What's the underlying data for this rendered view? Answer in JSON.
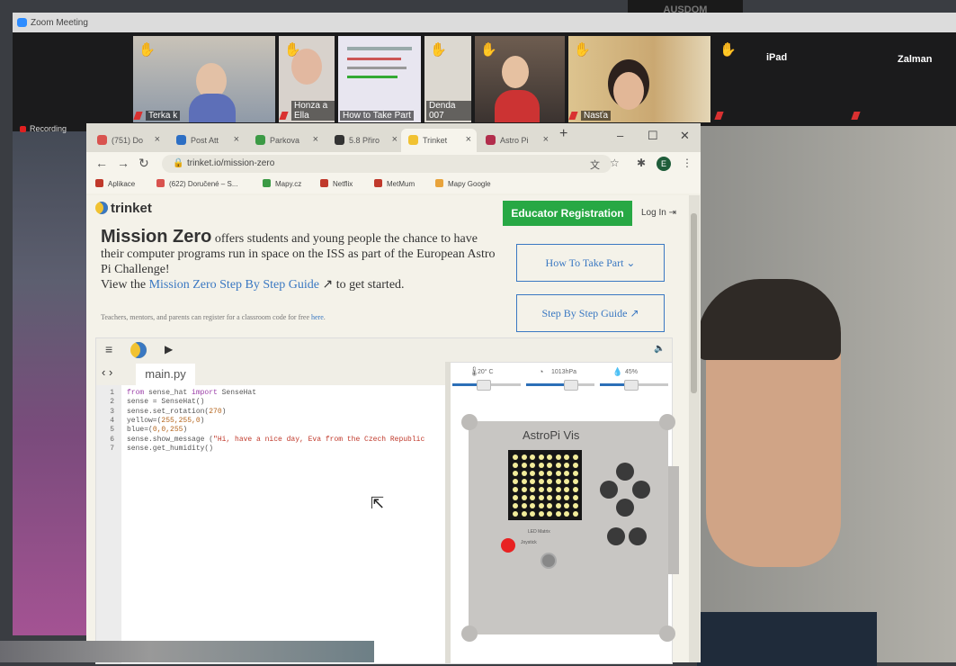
{
  "zoom": {
    "window_title": "Zoom Meeting",
    "notch_text": "AUSDOM",
    "recording_label": "Recording",
    "participants": [
      {
        "name": "Terka k"
      },
      {
        "name": "Honza a Ella"
      },
      {
        "name": "How to Take Part"
      },
      {
        "name": "Denda 007"
      },
      {
        "name": ""
      },
      {
        "name": "Nasťa"
      },
      {
        "name": "iPad"
      },
      {
        "name": "Zalman"
      }
    ]
  },
  "browser": {
    "tabs": [
      {
        "label": "(751) Do",
        "icon_color": "#d9534f"
      },
      {
        "label": "Post Att",
        "icon_color": "#2d6fc4"
      },
      {
        "label": "Parkova",
        "icon_color": "#3c9a45"
      },
      {
        "label": "5.8 Přiro",
        "icon_color": "#333333"
      },
      {
        "label": "Trinket",
        "icon_color": "#f1c232"
      },
      {
        "label": "Astro Pi",
        "icon_color": "#b22d4c"
      }
    ],
    "url": "trinket.io/mission-zero",
    "profile_initial": "E",
    "bookmarks": [
      {
        "label": "Aplikace",
        "icon_color": "#c0392b"
      },
      {
        "label": "(622) Doručené – S...",
        "icon_color": "#d9534f"
      },
      {
        "label": "Mapy.cz",
        "icon_color": "#3c9a45"
      },
      {
        "label": "Netflix",
        "icon_color": "#c0392b"
      },
      {
        "label": "MetMum",
        "icon_color": "#c0392b"
      },
      {
        "label": "Mapy Google",
        "icon_color": "#e8a33b"
      }
    ]
  },
  "trinket": {
    "logo": "trinket",
    "educator_button": "Educator Registration",
    "login": "Log In",
    "headline": "Mission Zero",
    "intro": "offers students and young people the chance to have their computer programs run in space on the ISS as part of the European Astro Pi Challenge!",
    "view_prefix": "View the",
    "guide_link": "Mission Zero Step By Step Guide",
    "view_suffix": "to get started.",
    "teachers_text": "Teachers, mentors, and parents can register for a classroom code for free",
    "teachers_link": "here",
    "how_to_button": "How To Take Part",
    "guide_button": "Step By Step Guide",
    "file_tab": "main.py",
    "code_lines": [
      {
        "n": "1",
        "segments": [
          {
            "t": "from",
            "c": "k"
          },
          {
            "t": " sense_hat ",
            "c": ""
          },
          {
            "t": "import",
            "c": "k"
          },
          {
            "t": " SenseHat",
            "c": ""
          }
        ]
      },
      {
        "n": "2",
        "segments": [
          {
            "t": "sense = SenseHat()",
            "c": ""
          }
        ]
      },
      {
        "n": "3",
        "segments": [
          {
            "t": "sense.set_rotation(",
            "c": ""
          },
          {
            "t": "270",
            "c": "n"
          },
          {
            "t": ")",
            "c": ""
          }
        ]
      },
      {
        "n": "4",
        "segments": [
          {
            "t": "yellow=(",
            "c": ""
          },
          {
            "t": "255,255,0",
            "c": "n"
          },
          {
            "t": ")",
            "c": ""
          }
        ]
      },
      {
        "n": "5",
        "segments": [
          {
            "t": "blue=(",
            "c": ""
          },
          {
            "t": "0,0,255",
            "c": "n"
          },
          {
            "t": ")",
            "c": ""
          }
        ]
      },
      {
        "n": "6",
        "segments": [
          {
            "t": "sense.show_message (",
            "c": ""
          },
          {
            "t": "\"Hi, have a nice day, Eva from the Czech Republic",
            "c": "s"
          }
        ]
      },
      {
        "n": "7",
        "segments": [
          {
            "t": "sense.get_humidity()",
            "c": ""
          }
        ]
      }
    ],
    "sensors": [
      {
        "label": "20° C",
        "icon": "thermometer-icon",
        "level": 0.45
      },
      {
        "label": "1013hPa",
        "icon": "pressure-icon",
        "level": 0.65
      },
      {
        "label": "45%",
        "icon": "humidity-icon",
        "level": 0.45
      }
    ],
    "astropi_title": "AstroPi Vis",
    "astropi_small_labels": [
      "LED Matrix",
      "Joystick"
    ]
  }
}
